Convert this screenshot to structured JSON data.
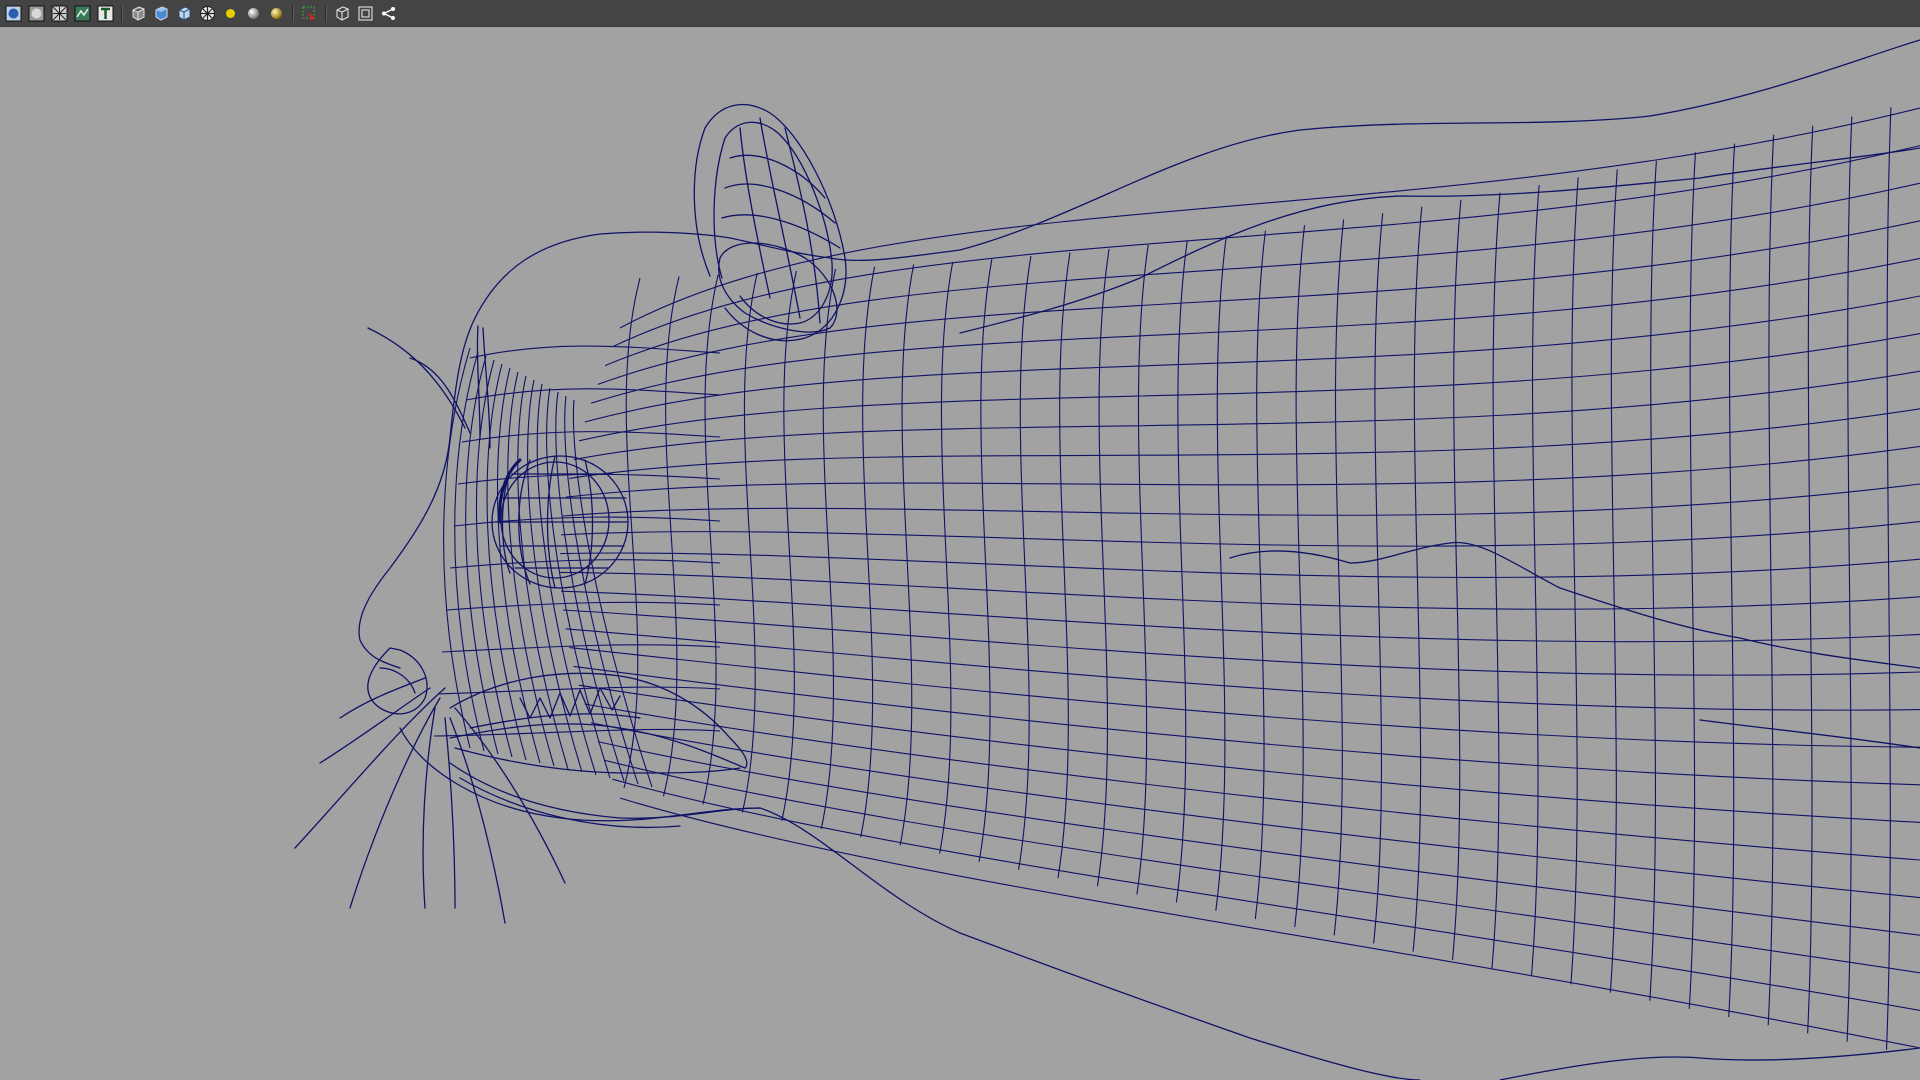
{
  "toolbar": {
    "groups": [
      [
        "smooth-shade-all-icon",
        "flat-shade-icon",
        "wireframe-on-shaded-icon",
        "textured-icon",
        "text-display-icon"
      ],
      [
        "wireframe-cube-icon",
        "shaded-cube-icon",
        "default-material-cube-icon",
        "checker-icon",
        "default-light-icon",
        "sphere-light-icon",
        "all-lights-icon"
      ],
      [
        "isolate-select-icon"
      ],
      [
        "camera-cube-icon",
        "frame-selection-icon",
        "share-node-icon"
      ]
    ]
  },
  "viewport": {
    "background_color": "#a2a2a2",
    "wire_color": "#101266",
    "display_mode": "wireframe",
    "subject": "rodent-head-wireframe-mesh"
  }
}
